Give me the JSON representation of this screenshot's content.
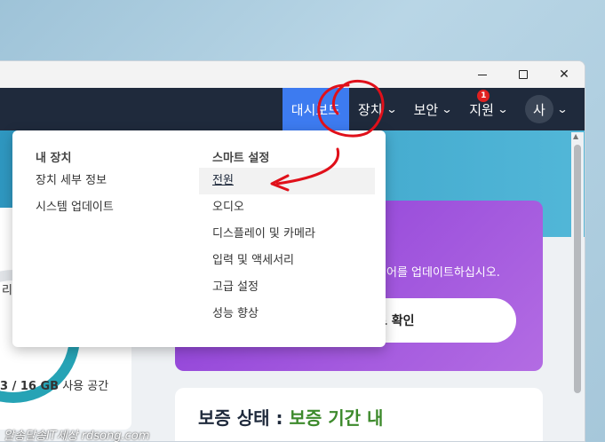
{
  "titlebar": {
    "minimize_icon": "minimize-icon",
    "maximize_icon": "maximize-icon",
    "close_icon": "close-icon"
  },
  "nav": {
    "items": [
      {
        "label": "대시보드",
        "active": true
      },
      {
        "label": "장치",
        "chevron": true
      },
      {
        "label": "보안",
        "chevron": true
      },
      {
        "label": "지원",
        "chevron": true,
        "badge": "1"
      }
    ],
    "avatar": "사"
  },
  "dropdown": {
    "col1": {
      "heading": "내 장치",
      "items": [
        "장치 세부 정보",
        "시스템 업데이트"
      ]
    },
    "col2": {
      "heading": "스마트 설정",
      "items": [
        "전원",
        "오디오",
        "디스플레이 및 카메라",
        "입력 및 액세서리",
        "고급 설정",
        "성능 향상"
      ]
    },
    "highlighted": "전원"
  },
  "left_card": {
    "partial_label": "리",
    "storage_used": "3 / 16 GB",
    "storage_suffix": "사용 공간"
  },
  "promo": {
    "text": "어를 업데이트하십시오.",
    "button": "트 확인"
  },
  "warranty": {
    "label": "보증 상태 :",
    "status": "보증 기간 내"
  },
  "watermark": "알송달송IT세상 rdsong.com",
  "colors": {
    "nav_bg": "#1f2a3c",
    "nav_active": "#3d7bf0",
    "promo": "#8a3bd6",
    "warranty_ok": "#3d8a2c",
    "annotation": "#e0101a"
  }
}
